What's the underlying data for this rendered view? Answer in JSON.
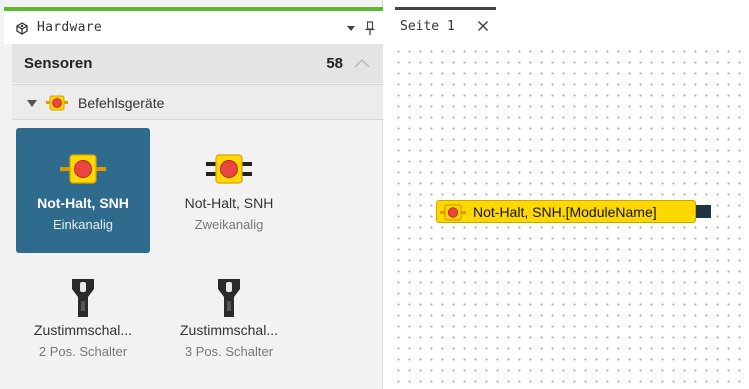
{
  "panel": {
    "title": "Hardware",
    "icons": {
      "panel": "hardware-icon",
      "dropdown": "chevron-down-icon",
      "pin": "pin-icon"
    }
  },
  "category": {
    "title": "Sensoren",
    "count": "58",
    "collapse_icon": "chevron-up-icon"
  },
  "group": {
    "label": "Befehlsgeräte",
    "icon": "emergency-stop-icon"
  },
  "tiles": [
    {
      "title": "Not-Halt, SNH",
      "subtitle": "Einkanalig",
      "icon": "emergency-stop-single-icon",
      "selected": true
    },
    {
      "title": "Not-Halt, SNH",
      "subtitle": "Zweikanalig",
      "icon": "emergency-stop-dual-icon",
      "selected": false
    },
    {
      "title": "Zustimmschal...",
      "subtitle": "2 Pos. Schalter",
      "icon": "enabling-switch-icon",
      "selected": false
    },
    {
      "title": "Zustimmschal...",
      "subtitle": "3 Pos. Schalter",
      "icon": "enabling-switch-icon",
      "selected": false
    }
  ],
  "tabs": [
    {
      "label": "Seite 1",
      "close_icon": "close-icon"
    }
  ],
  "canvas": {
    "module": {
      "label": "Not-Halt, SNH.[ModuleName]",
      "icon": "emergency-stop-icon"
    }
  },
  "colors": {
    "accent": "#5cb82e",
    "selected_tile": "#2f6b8c",
    "module": "#ffd800",
    "port": "#1f3343"
  }
}
